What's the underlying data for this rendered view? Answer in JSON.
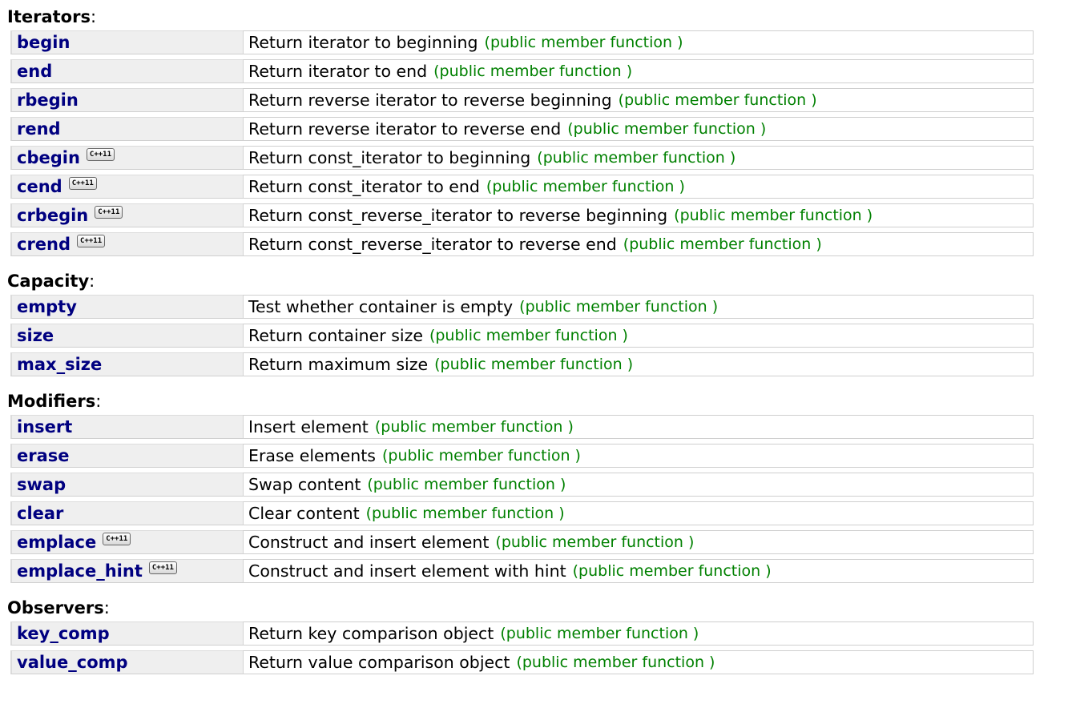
{
  "sections": [
    {
      "title": "Iterators",
      "rows": [
        {
          "name": "begin",
          "desc": "Return iterator to beginning",
          "type": "(public member function )"
        },
        {
          "name": "end",
          "desc": "Return iterator to end",
          "type": "(public member function )"
        },
        {
          "name": "rbegin",
          "desc": "Return reverse iterator to reverse beginning",
          "type": "(public member function )"
        },
        {
          "name": "rend",
          "desc": "Return reverse iterator to reverse end",
          "type": "(public member function )"
        },
        {
          "name": "cbegin",
          "badge": "C++11",
          "desc": "Return const_iterator to beginning",
          "type": "(public member function )"
        },
        {
          "name": "cend",
          "badge": "C++11",
          "desc": "Return const_iterator to end",
          "type": "(public member function )"
        },
        {
          "name": "crbegin",
          "badge": "C++11",
          "desc": "Return const_reverse_iterator to reverse beginning",
          "type": "(public member function )"
        },
        {
          "name": "crend",
          "badge": "C++11",
          "desc": "Return const_reverse_iterator to reverse end",
          "type": "(public member function )"
        }
      ]
    },
    {
      "title": "Capacity",
      "rows": [
        {
          "name": "empty",
          "desc": "Test whether container is empty",
          "type": "(public member function )"
        },
        {
          "name": "size",
          "desc": "Return container size",
          "type": "(public member function )"
        },
        {
          "name": "max_size",
          "desc": "Return maximum size",
          "type": "(public member function )"
        }
      ]
    },
    {
      "title": "Modifiers",
      "rows": [
        {
          "name": "insert",
          "desc": "Insert element",
          "type": "(public member function )"
        },
        {
          "name": "erase",
          "desc": "Erase elements",
          "type": "(public member function )"
        },
        {
          "name": "swap",
          "desc": "Swap content",
          "type": "(public member function )"
        },
        {
          "name": "clear",
          "desc": "Clear content",
          "type": "(public member function )"
        },
        {
          "name": "emplace",
          "badge": "C++11",
          "desc": "Construct and insert element",
          "type": "(public member function )"
        },
        {
          "name": "emplace_hint",
          "badge": "C++11",
          "desc": "Construct and insert element with hint",
          "type": "(public member function )"
        }
      ]
    },
    {
      "title": "Observers",
      "rows": [
        {
          "name": "key_comp",
          "desc": "Return key comparison object",
          "type": "(public member function )"
        },
        {
          "name": "value_comp",
          "desc": "Return value comparison object",
          "type": "(public member function )"
        }
      ]
    }
  ],
  "heading_suffix": ":",
  "colors": {
    "link": "#000080",
    "type_note": "#008000",
    "name_bg": "#efefef"
  }
}
